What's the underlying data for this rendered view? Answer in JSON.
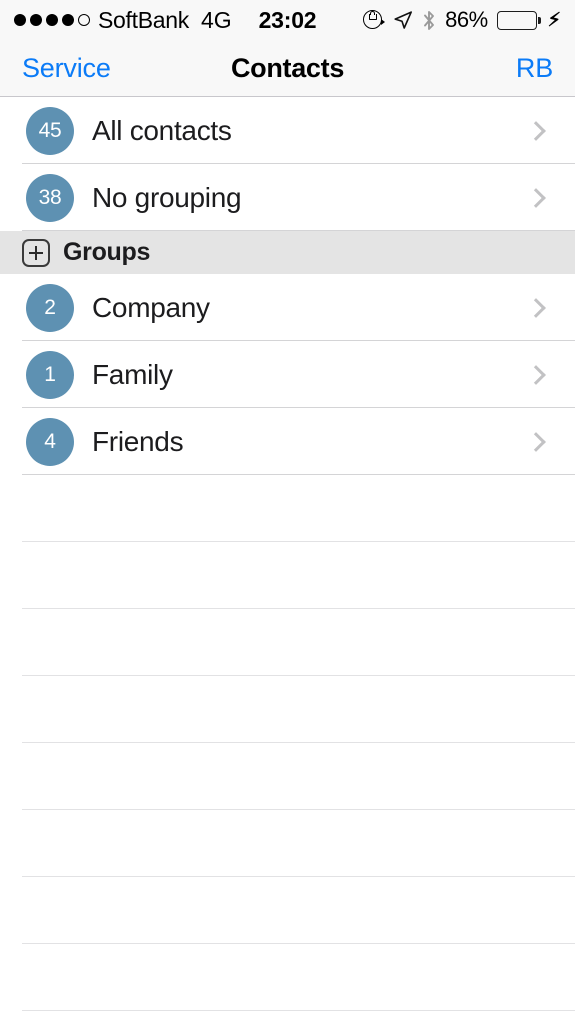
{
  "status_bar": {
    "signal_dots_filled": 4,
    "signal_dots_total": 5,
    "carrier": "SoftBank",
    "network": "4G",
    "time": "23:02",
    "rotation_lock_icon": "rotation-lock-icon",
    "location_icon": "location-arrow-icon",
    "bluetooth_icon": "bluetooth-icon",
    "battery_percent": "86%",
    "battery_level": 86,
    "battery_color": "#4cd964",
    "charging_icon": "lightning-bolt-icon"
  },
  "nav_bar": {
    "back_label": "Service",
    "title": "Contacts",
    "right_label": "RB",
    "tint_color": "#0b7bf7"
  },
  "list": {
    "top_items": [
      {
        "count": "45",
        "label": "All contacts",
        "chevron": "chevron-right-icon"
      },
      {
        "count": "38",
        "label": "No grouping",
        "chevron": "chevron-right-icon"
      }
    ],
    "section": {
      "add_icon": "plus-square-icon",
      "title": "Groups"
    },
    "groups": [
      {
        "count": "2",
        "label": "Company",
        "chevron": "chevron-right-icon"
      },
      {
        "count": "1",
        "label": "Family",
        "chevron": "chevron-right-icon"
      },
      {
        "count": "4",
        "label": "Friends",
        "chevron": "chevron-right-icon"
      }
    ],
    "empty_row_count": 8,
    "badge_color": "#5e91b2",
    "separator_color": "#d4d4d6"
  }
}
